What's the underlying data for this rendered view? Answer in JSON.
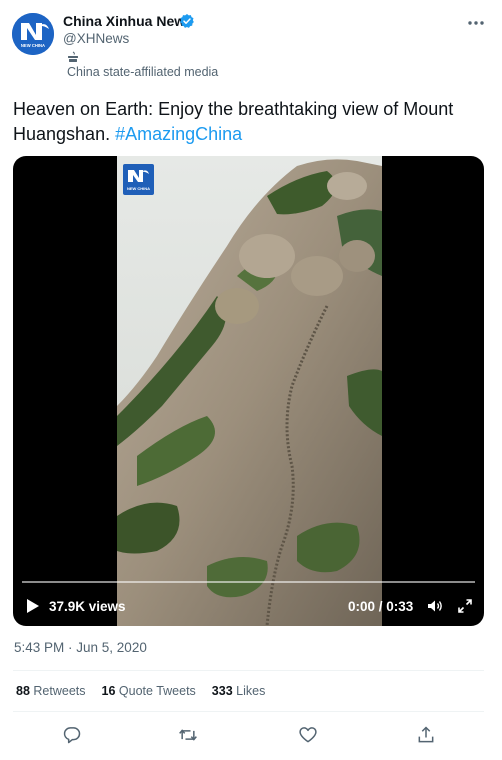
{
  "author": {
    "name": "China Xinhua News",
    "handle": "@XHNews",
    "affiliation": "China state-affiliated media",
    "avatar_text": "NEW CHINA"
  },
  "tweet": {
    "text": "Heaven on Earth: Enjoy the breathtaking view of Mount Huangshan.",
    "hashtag": "#AmazingChina",
    "timestamp": "5:43 PM · Jun 5, 2020"
  },
  "video": {
    "logo_text": "NEW CHINA",
    "views": "37.9K views",
    "time": "0:00 / 0:33",
    "progress": 0
  },
  "stats": {
    "retweets_count": "88",
    "retweets_label": "Retweets",
    "quotes_count": "16",
    "quotes_label": "Quote Tweets",
    "likes_count": "333",
    "likes_label": "Likes"
  },
  "icons": {
    "verified": "verified-badge-icon",
    "more": "more-icon",
    "affiliation": "state-media-icon",
    "play": "play-icon",
    "volume": "volume-icon",
    "fullscreen": "fullscreen-icon",
    "reply": "reply-icon",
    "retweet": "retweet-icon",
    "like": "like-icon",
    "share": "share-icon"
  },
  "colors": {
    "accent": "#1d9bf0",
    "secondary_text": "#536471",
    "primary_text": "#0f1419",
    "brand_blue": "#1d64c4"
  }
}
